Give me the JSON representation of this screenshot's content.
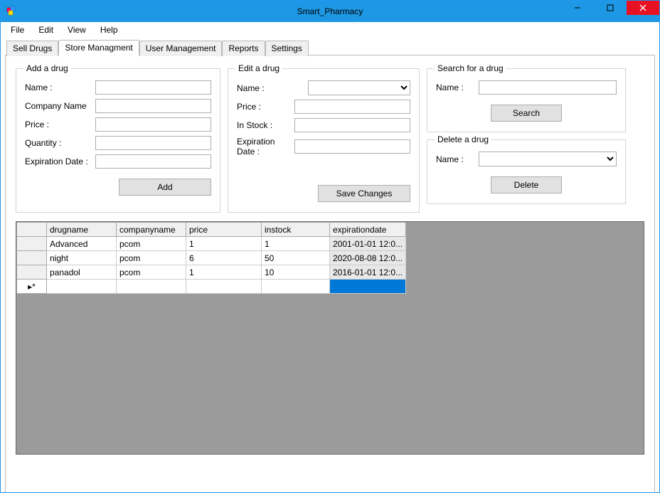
{
  "window": {
    "title": "Smart_Pharmacy"
  },
  "menu": {
    "file": "File",
    "edit": "Edit",
    "view": "View",
    "help": "Help"
  },
  "tabs": {
    "sell": "Sell Drugs",
    "store": "Store Managment",
    "user": "User Management",
    "reports": "Reports",
    "settings": "Settings"
  },
  "groups": {
    "add": {
      "legend": "Add a drug",
      "name": "Name :",
      "company": "Company Name",
      "price": "Price :",
      "quantity": "Quantity :",
      "expiration": "Expiration Date :",
      "button": "Add"
    },
    "edit": {
      "legend": "Edit a drug",
      "name": "Name :",
      "price": "Price :",
      "instock": "In Stock :",
      "expiration": "Expiration Date :",
      "button": "Save Changes"
    },
    "search": {
      "legend": "Search for a drug",
      "name": "Name :",
      "button": "Search"
    },
    "delete": {
      "legend": "Delete a drug",
      "name": "Name :",
      "button": "Delete"
    }
  },
  "grid": {
    "headers": {
      "drugname": "drugname",
      "companyname": "companyname",
      "price": "price",
      "instock": "instock",
      "expirationdate": "expirationdate"
    },
    "rows": [
      {
        "drugname": "Advanced",
        "companyname": "pcom",
        "price": "1",
        "instock": "1",
        "expirationdate": "2001-01-01 12:0..."
      },
      {
        "drugname": "night",
        "companyname": "pcom",
        "price": "6",
        "instock": "50",
        "expirationdate": "2020-08-08 12:0..."
      },
      {
        "drugname": "panadol",
        "companyname": "pcom",
        "price": "1",
        "instock": "10",
        "expirationdate": "2016-01-01 12:0..."
      }
    ],
    "new_row_marker": "▸*"
  }
}
